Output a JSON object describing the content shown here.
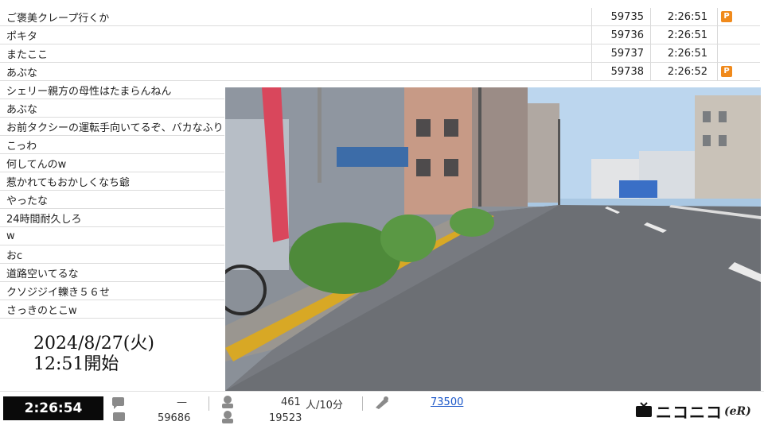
{
  "comments_full": [
    {
      "text": "ご褒美クレープ行くか",
      "number": "59735",
      "time": "2:26:51",
      "premium": true
    },
    {
      "text": "ポキタ",
      "number": "59736",
      "time": "2:26:51",
      "premium": false
    },
    {
      "text": "またここ",
      "number": "59737",
      "time": "2:26:51",
      "premium": false
    },
    {
      "text": "あぶな",
      "number": "59738",
      "time": "2:26:52",
      "premium": true
    }
  ],
  "comments_short": [
    "シェリー親方の母性はたまらんねん",
    "あぶな",
    "お前タクシーの運転手向いてるぞ、バカなふりし",
    "こっわ",
    "何してんのw",
    "惹かれてもおかしくなち爺",
    "やったな",
    "24時間耐久しろ",
    "w",
    "おc",
    "道路空いてるな",
    "クソジジイ轢き５６せ",
    "さっきのとこw"
  ],
  "premium_badge": "P",
  "caption": {
    "date": "2024/8/27(火)",
    "start": "12:51開始"
  },
  "bottom": {
    "elapsed": "2:26:54",
    "comments_dash": "—",
    "comments_count": "59686",
    "viewers_rate": "461",
    "viewers_rate_unit": "人/10分",
    "visitors": "19523",
    "ad_points": "73500",
    "logo_text": "ニコニコ",
    "logo_suffix": "(eR)"
  },
  "colors": {
    "premium": "#f08a1c",
    "link": "#1a56c8",
    "elapsed_bg": "#0a0a0a"
  },
  "icons": [
    "comment-icon",
    "viewer-icon",
    "ad-icon",
    "tv-icon"
  ]
}
